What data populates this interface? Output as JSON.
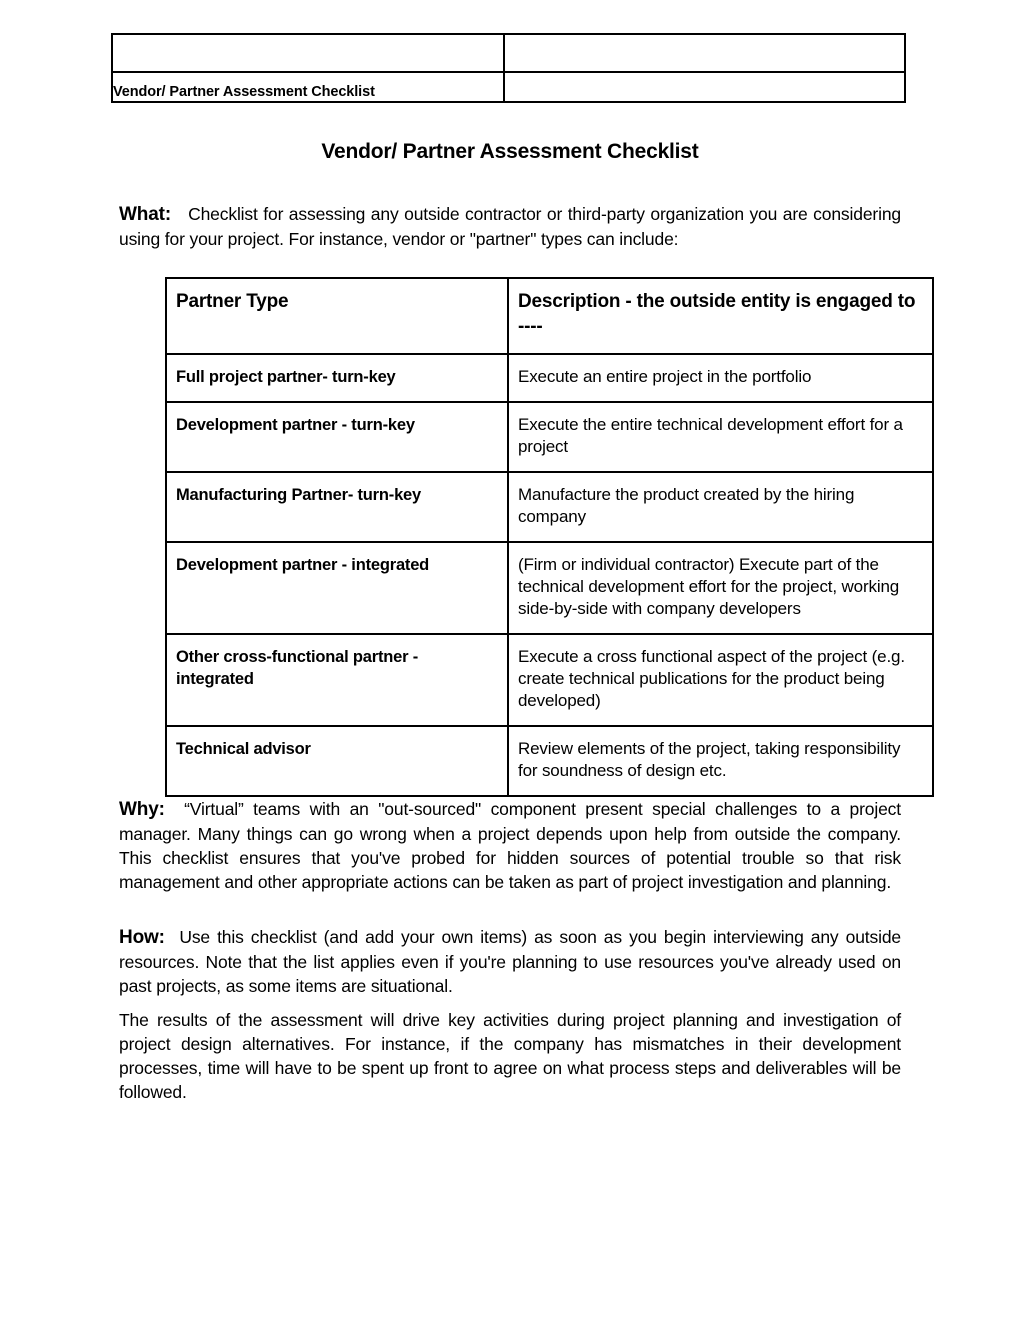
{
  "header_table": {
    "doc_title": "Vendor/ Partner Assessment Checklist",
    "top_left_cell": "",
    "top_right_cell": "",
    "bottom_right_cell": ""
  },
  "document": {
    "title": "Vendor/ Partner Assessment Checklist"
  },
  "paragraphs": {
    "what": {
      "lead": "What:",
      "body": "Checklist for assessing any outside contractor or third-party organization you are considering using for your project.   For instance, vendor or  \"partner\" types can include:"
    },
    "why": {
      "lead": "Why:",
      "body": "“Virtual” teams with an \"out-sourced\" component present special challenges to a project manager. Many things can go wrong when a project depends upon help from outside the company.  This checklist ensures that you've probed for hidden sources of potential trouble so that risk management and other appropriate actions can be taken as part of project investigation and planning."
    },
    "how": {
      "lead": "How:",
      "body": "Use this checklist (and add your own items) as soon as you begin interviewing any outside resources.  Note that the list applies even if you're planning to use resources you've already used on past projects, as some items are situational."
    },
    "results": {
      "lead": "",
      "body": "The results of the assessment will drive key activities during project planning and investigation of project design alternatives.   For instance, if the company has mismatches in their development processes, time will have to be spent up front to agree on what process steps and deliverables will be followed."
    }
  },
  "partner_table": {
    "headers": {
      "col1": "Partner Type",
      "col2": "Description - the outside entity is engaged to ----"
    },
    "rows": [
      {
        "type": "Full project partner- turn-key",
        "description": "Execute an entire project in the portfolio"
      },
      {
        "type": "Development partner - turn-key",
        "description": "Execute the entire technical development effort for a project"
      },
      {
        "type": "Manufacturing Partner- turn-key",
        "description": "Manufacture the product created by the hiring company"
      },
      {
        "type": "Development partner - integrated",
        "description": "(Firm or individual contractor) Execute part of the technical development effort for the project, working side-by-side with company developers"
      },
      {
        "type": "Other cross-functional partner - integrated",
        "description": "Execute a cross functional aspect of the project (e.g. create technical publications for the product being developed)"
      },
      {
        "type": "Technical advisor",
        "description": "Review elements of the project, taking responsibility for soundness of design etc."
      }
    ]
  }
}
